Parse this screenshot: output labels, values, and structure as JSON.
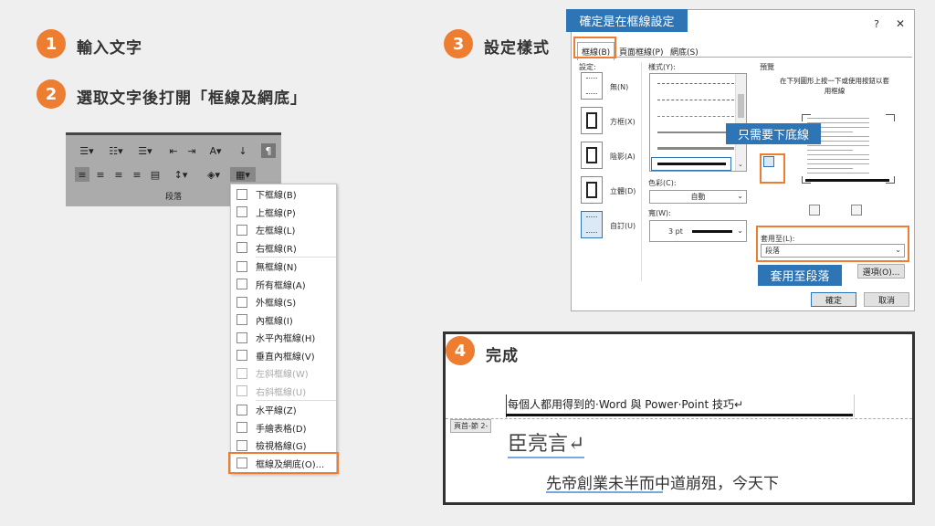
{
  "steps": {
    "s1": {
      "num": "1",
      "label": "輸入文字"
    },
    "s2": {
      "num": "2",
      "label": "選取文字後打開「框線及網底」"
    },
    "s3": {
      "num": "3",
      "label": "設定樣式"
    },
    "s4": {
      "num": "4",
      "label": "完成"
    }
  },
  "ribbon": {
    "group_label": "段落"
  },
  "border_menu": {
    "items": [
      "下框線(B)",
      "上框線(P)",
      "左框線(L)",
      "右框線(R)",
      "無框線(N)",
      "所有框線(A)",
      "外框線(S)",
      "內框線(I)",
      "水平內框線(H)",
      "垂直內框線(V)",
      "左斜框線(W)",
      "右斜框線(U)",
      "水平線(Z)",
      "手繪表格(D)",
      "檢視格線(G)",
      "框線及網底(O)..."
    ]
  },
  "dialog": {
    "tag": "確定是在框線設定",
    "help": "?",
    "close": "✕",
    "tabs": [
      "框線(B)",
      "頁面框線(P)",
      "網底(S)"
    ],
    "settings_label": "設定:",
    "settings": [
      "無(N)",
      "方框(X)",
      "陰影(A)",
      "立體(D)",
      "自訂(U)"
    ],
    "style_label": "樣式(Y):",
    "color_label": "色彩(C):",
    "color_value": "自動",
    "width_label": "寬(W):",
    "width_value": "3 pt",
    "preview_label": "預覽",
    "preview_hint": "在下列圖形上按一下或使用按鈕以套用框線",
    "bottom_tag": "只需要下底線",
    "apply_label": "套用至(L):",
    "apply_value": "段落",
    "apply_tag": "套用至段落",
    "options_btn": "選項(O)...",
    "ok_btn": "確定",
    "cancel_btn": "取消"
  },
  "doc": {
    "header_text": "每個人都用得到的·Word 與 Power·Point 技巧↵",
    "header_tag": "頁首-節 2-",
    "title": "臣亮言↵",
    "body": "先帝創業未半而中道崩殂，今天下"
  }
}
